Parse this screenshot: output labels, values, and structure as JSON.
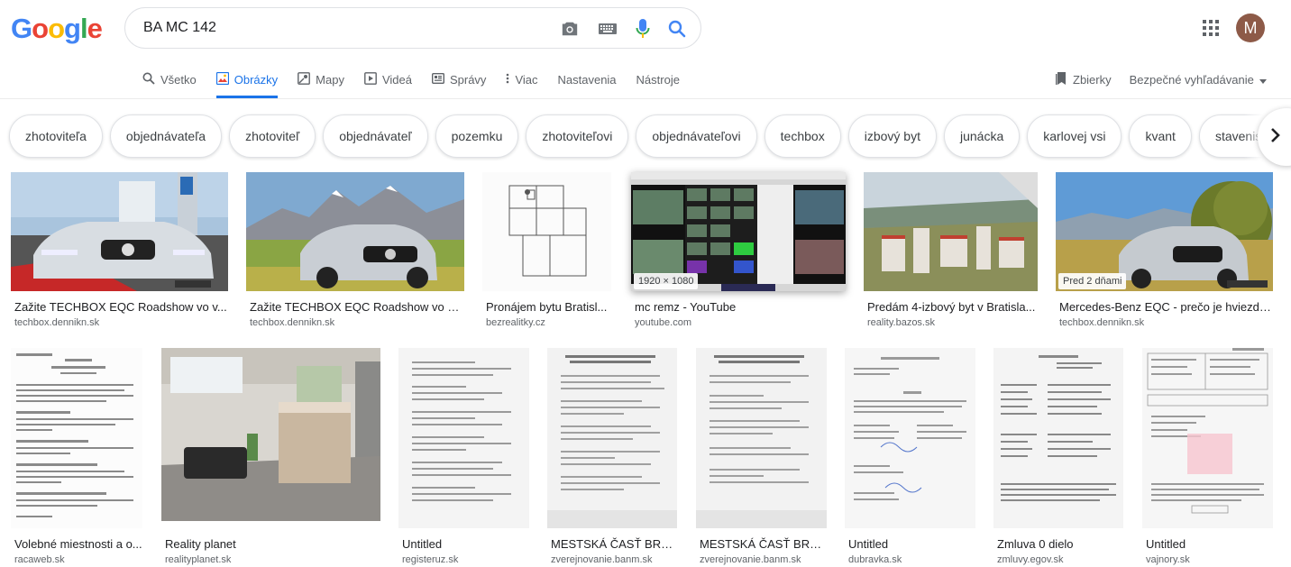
{
  "search": {
    "query": "BA MC 142"
  },
  "user": {
    "initial": "M"
  },
  "tabs": [
    {
      "label": "Všetko",
      "icon": "search-icon"
    },
    {
      "label": "Obrázky",
      "icon": "image-icon"
    },
    {
      "label": "Mapy",
      "icon": "map-icon"
    },
    {
      "label": "Videá",
      "icon": "video-icon"
    },
    {
      "label": "Správy",
      "icon": "news-icon"
    },
    {
      "label": "Viac",
      "icon": "more-vert-icon"
    },
    {
      "label": "Nastavenia",
      "icon": ""
    },
    {
      "label": "Nástroje",
      "icon": ""
    }
  ],
  "tabs_right": {
    "collections": "Zbierky",
    "safe_search": "Bezpečné vyhľadávanie"
  },
  "chips": [
    "zhotoviteľa",
    "objednávateľa",
    "zhotoviteľ",
    "objednávateľ",
    "pozemku",
    "zhotoviteľovi",
    "objednávateľovi",
    "techbox",
    "izbový byt",
    "junácka",
    "karlovej vsi",
    "kvant",
    "staveniska"
  ],
  "results_row1": [
    {
      "title": "Zažite TECHBOX EQC Roadshow vo v...",
      "site": "techbox.dennikn.sk",
      "badge": ""
    },
    {
      "title": "Zažite TECHBOX EQC Roadshow vo va...",
      "site": "techbox.dennikn.sk",
      "badge": ""
    },
    {
      "title": "Pronájem bytu Bratisl...",
      "site": "bezrealitky.cz",
      "badge": ""
    },
    {
      "title": "mc remz - YouTube",
      "site": "youtube.com",
      "badge": "1920 × 1080"
    },
    {
      "title": "Predám 4-izbový byt v Bratisla...",
      "site": "reality.bazos.sk",
      "badge": ""
    },
    {
      "title": "Mercedes-Benz EQC - prečo je hviezdo...",
      "site": "techbox.dennikn.sk",
      "badge": "Pred 2 dňami"
    }
  ],
  "results_row2": [
    {
      "title": "Volebné miestnosti a o...",
      "site": "racaweb.sk"
    },
    {
      "title": "Reality planet",
      "site": "realityplanet.sk"
    },
    {
      "title": "Untitled",
      "site": "registeruz.sk"
    },
    {
      "title": "MESTSKÁ ČASŤ BRA...",
      "site": "zverejnovanie.banm.sk"
    },
    {
      "title": "MESTSKÁ ČASŤ BRA...",
      "site": "zverejnovanie.banm.sk"
    },
    {
      "title": "Untitled",
      "site": "dubravka.sk"
    },
    {
      "title": "Zmluva 0 dielo",
      "site": "zmluvy.egov.sk"
    },
    {
      "title": "Untitled",
      "site": "vajnory.sk"
    }
  ],
  "colors": {
    "accent": "#1a73e8",
    "google_blue": "#4285f4",
    "google_red": "#ea4335",
    "google_yellow": "#fbbc05",
    "google_green": "#34a853"
  }
}
